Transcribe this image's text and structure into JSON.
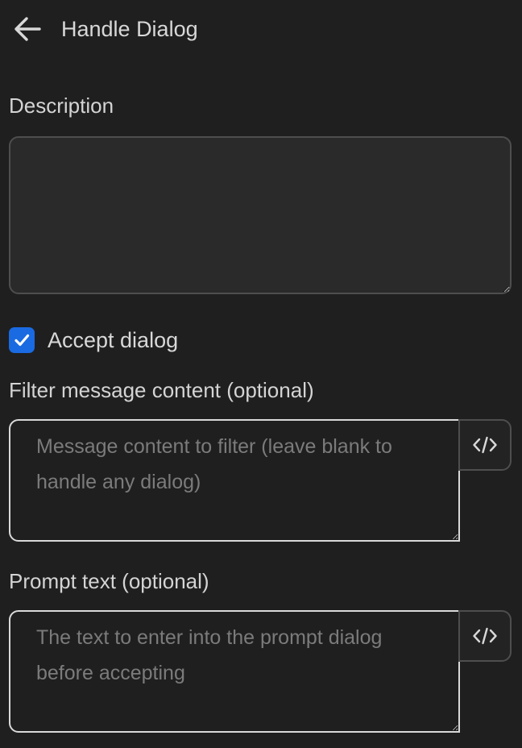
{
  "header": {
    "title": "Handle Dialog",
    "back_icon": "arrow-left-icon"
  },
  "description": {
    "label": "Description",
    "value": ""
  },
  "accept_dialog": {
    "label": "Accept dialog",
    "checked": true,
    "color": "#1a6ae2"
  },
  "filter_message": {
    "label": "Filter message content (optional)",
    "placeholder": "Message content to filter (leave blank to handle any dialog)",
    "value": "",
    "button_icon": "code-icon"
  },
  "prompt_text": {
    "label": "Prompt text (optional)",
    "placeholder": "The text to enter into the prompt dialog before accepting",
    "value": "",
    "button_icon": "code-icon"
  }
}
